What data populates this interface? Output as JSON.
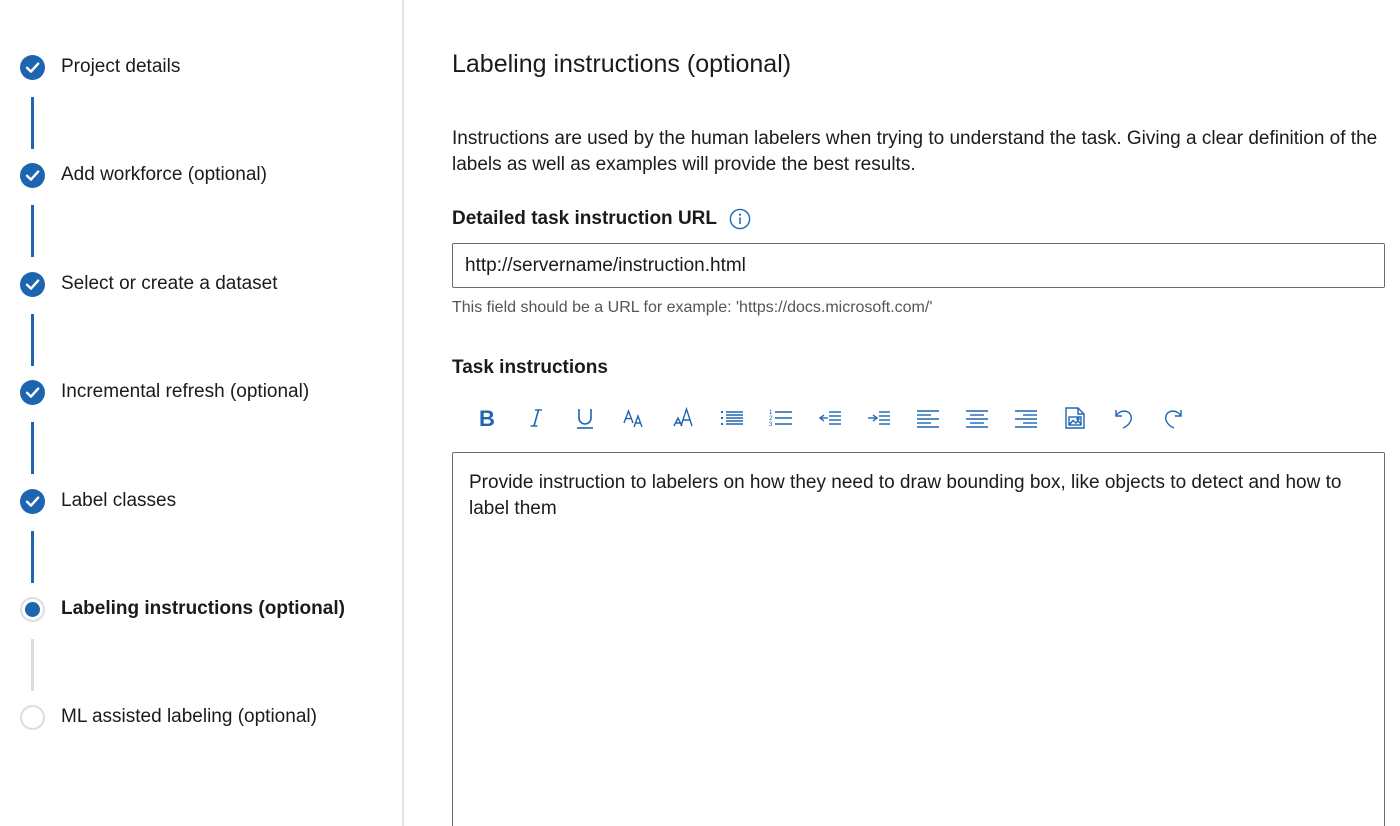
{
  "stepper": {
    "steps": [
      {
        "label": "Project details",
        "status": "completed"
      },
      {
        "label": "Add workforce (optional)",
        "status": "completed"
      },
      {
        "label": "Select or create a dataset",
        "status": "completed"
      },
      {
        "label": "Incremental refresh (optional)",
        "status": "completed"
      },
      {
        "label": "Label classes",
        "status": "completed"
      },
      {
        "label": "Labeling instructions (optional)",
        "status": "current"
      },
      {
        "label": "ML assisted labeling (optional)",
        "status": "pending"
      }
    ]
  },
  "main": {
    "title": "Labeling instructions (optional)",
    "description": "Instructions are used by the human labelers when trying to understand the task. Giving a clear definition of the labels as well as examples will provide the best results.",
    "url_field": {
      "label": "Detailed task instruction URL",
      "value": "http://servername/instruction.html",
      "helper": "This field should be a URL for example: 'https://docs.microsoft.com/'"
    },
    "task_instructions": {
      "label": "Task instructions",
      "toolbar": [
        "bold-icon",
        "italic-icon",
        "underline-icon",
        "font-size-icon",
        "font-style-icon",
        "bulleted-list-icon",
        "numbered-list-icon",
        "decrease-indent-icon",
        "increase-indent-icon",
        "align-left-icon",
        "align-center-icon",
        "align-right-icon",
        "insert-image-icon",
        "undo-icon",
        "redo-icon"
      ],
      "content": "Provide instruction to labelers on how they need to draw bounding box, like objects to detect and how to label them"
    }
  },
  "colors": {
    "accent": "#1e65b0",
    "border": "#6b6b6b",
    "divider": "#e3e3e3",
    "pending": "#dcdcdc"
  }
}
